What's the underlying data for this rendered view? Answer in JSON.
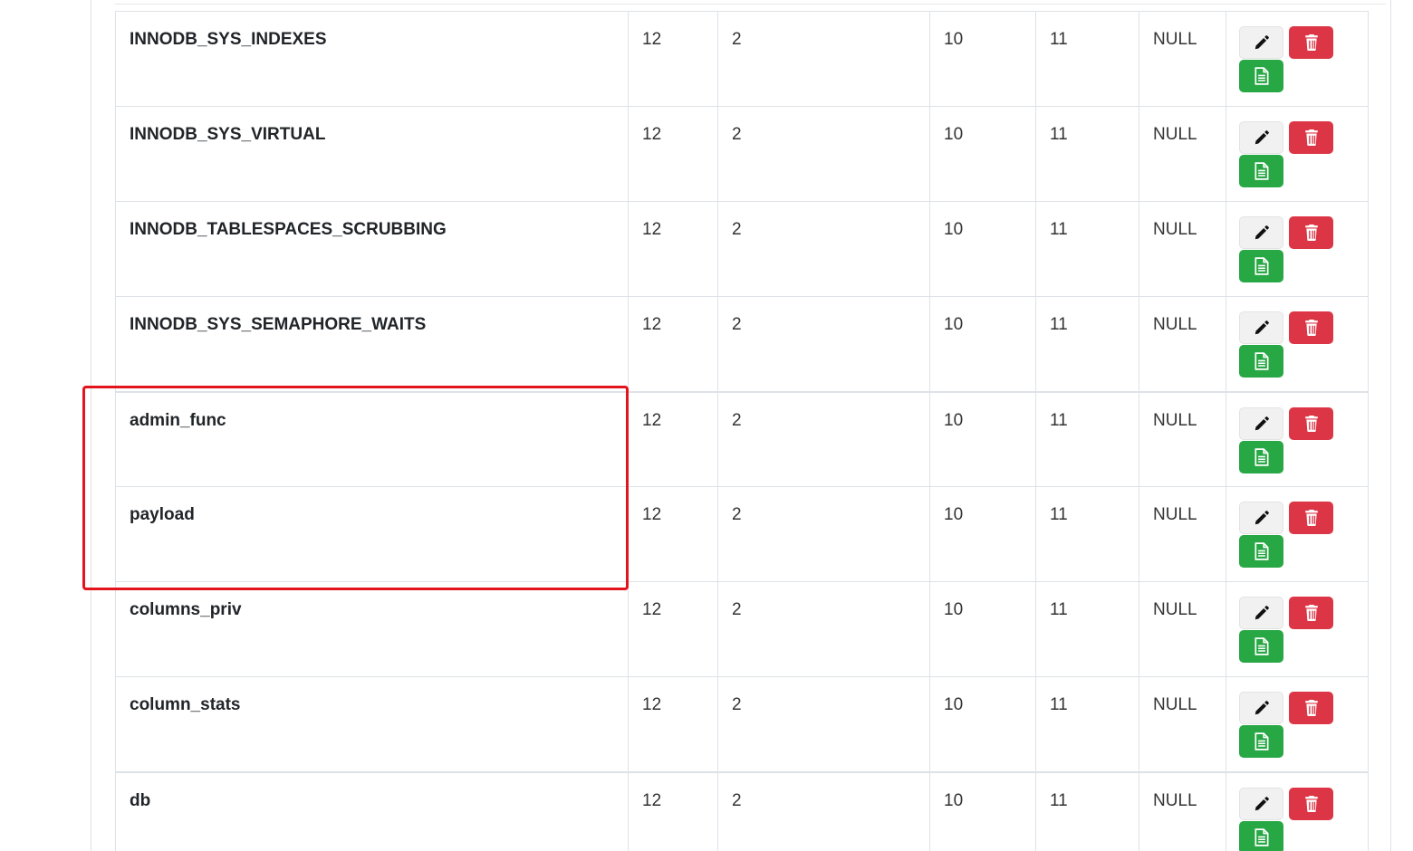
{
  "table": {
    "rows": [
      {
        "name": "INNODB_SYS_INDEXES",
        "c1": "12",
        "c2": "2",
        "c3": "10",
        "c4": "11",
        "c5": "NULL"
      },
      {
        "name": "INNODB_SYS_VIRTUAL",
        "c1": "12",
        "c2": "2",
        "c3": "10",
        "c4": "11",
        "c5": "NULL"
      },
      {
        "name": "INNODB_TABLESPACES_SCRUBBING",
        "c1": "12",
        "c2": "2",
        "c3": "10",
        "c4": "11",
        "c5": "NULL"
      },
      {
        "name": "INNODB_SYS_SEMAPHORE_WAITS",
        "c1": "12",
        "c2": "2",
        "c3": "10",
        "c4": "11",
        "c5": "NULL"
      },
      {
        "name": "admin_func",
        "c1": "12",
        "c2": "2",
        "c3": "10",
        "c4": "11",
        "c5": "NULL"
      },
      {
        "name": "payload",
        "c1": "12",
        "c2": "2",
        "c3": "10",
        "c4": "11",
        "c5": "NULL"
      },
      {
        "name": "columns_priv",
        "c1": "12",
        "c2": "2",
        "c3": "10",
        "c4": "11",
        "c5": "NULL"
      },
      {
        "name": "column_stats",
        "c1": "12",
        "c2": "2",
        "c3": "10",
        "c4": "11",
        "c5": "NULL"
      },
      {
        "name": "db",
        "c1": "12",
        "c2": "2",
        "c3": "10",
        "c4": "11",
        "c5": "NULL"
      }
    ]
  },
  "actions": {
    "edit_icon": "pencil-icon",
    "delete_icon": "trash-icon",
    "document_icon": "document-icon"
  },
  "colors": {
    "delete": "#dc3545",
    "document": "#28a745",
    "edit": "#f1f1f1",
    "highlight": "#e3141c"
  }
}
